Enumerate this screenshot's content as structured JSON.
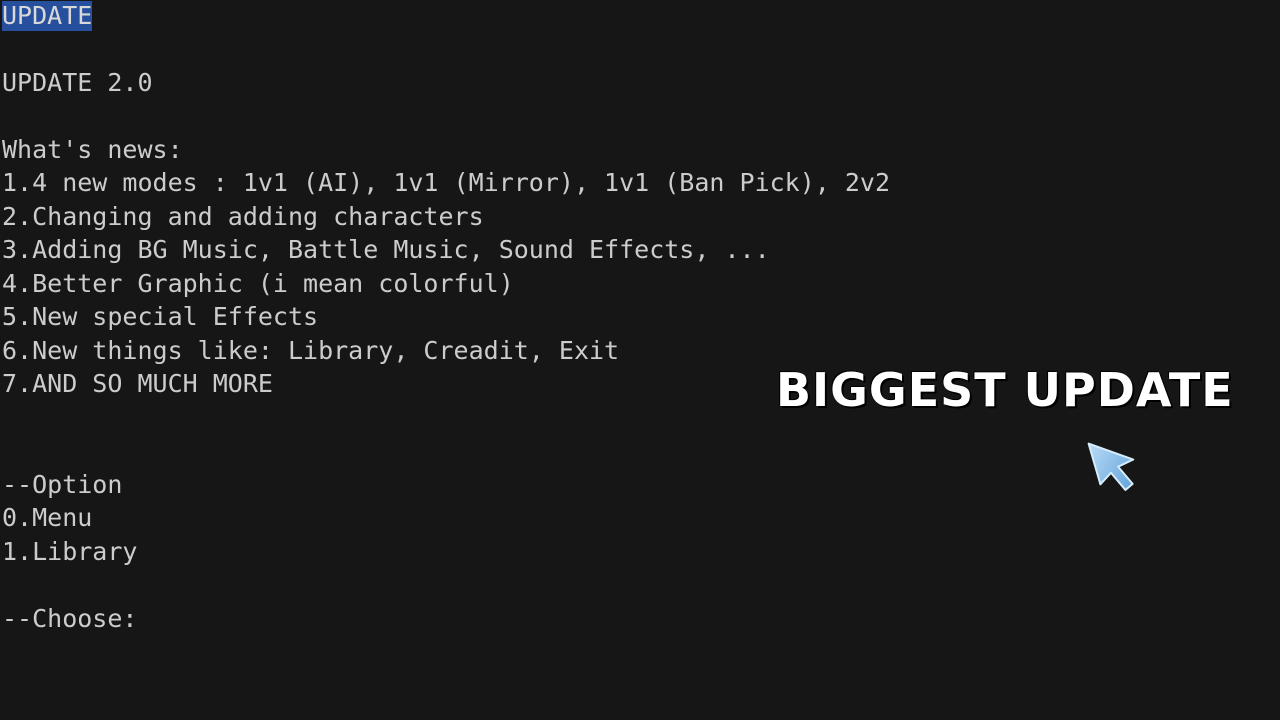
{
  "console": {
    "selected_line": "UPDATE",
    "title_line": "UPDATE 2.0",
    "news_header": "What's news:",
    "news_items": [
      "1.4 new modes : 1v1 (AI), 1v1 (Mirror), 1v1 (Ban Pick), 2v2",
      "2.Changing and adding characters",
      "3.Adding BG Music, Battle Music, Sound Effects, ...",
      "4.Better Graphic (i mean colorful)",
      "5.New special Effects",
      "6.New things like: Library, Creadit, Exit",
      "7.AND SO MUCH MORE"
    ],
    "option_header": "--Option",
    "options": [
      "0.Menu",
      "1.Library"
    ],
    "prompt": "--Choose:"
  },
  "overlay": {
    "banner_text": "BIGGEST UPDATE",
    "cursor_icon": "pointer-cursor-icon"
  },
  "colors": {
    "background": "#161616",
    "text": "#cccccc",
    "selection": "#264f9e",
    "banner": "#ffffff",
    "cursor": "#7fb8e8"
  }
}
